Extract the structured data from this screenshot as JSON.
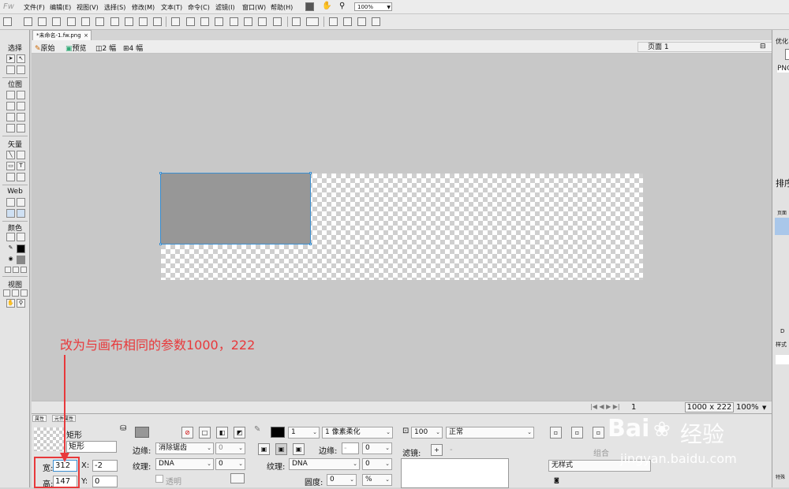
{
  "app": {
    "logo_text": "Fw",
    "menus": [
      "文件(F)",
      "编辑(E)",
      "视图(V)",
      "选择(S)",
      "修改(M)",
      "文本(T)",
      "命令(C)",
      "滤镜(I)",
      "窗口(W)",
      "帮助(H)"
    ],
    "zoom": "100%"
  },
  "document": {
    "tab_title": "*未命名-1.fw.png",
    "close": "×"
  },
  "view_tabs": [
    "原始",
    "预览",
    "2 幅",
    "4 幅"
  ],
  "page_selector": "页面 1",
  "tools": {
    "select_title": "选择",
    "bitmap_title": "位图",
    "vector_title": "矢量",
    "web_title": "Web",
    "colors_title": "颜色",
    "view_title": "视图"
  },
  "annotation": "改为与画布相同的参数1000，222",
  "status": {
    "page_number": "1",
    "canvas_size": "1000 x 222",
    "zoom": "100%"
  },
  "right_panel": {
    "optimize_label": "优化",
    "png_label": "PNG",
    "sort_label": "排序",
    "pages_label": "页面",
    "styles_label": "样式",
    "special_label": "特殊"
  },
  "properties": {
    "tab_props": "属性",
    "tab_symbols": "元件属性",
    "object_kind": "矩形",
    "object_name": "矩形",
    "width_label": "宽:",
    "width_value": "312",
    "height_label": "高:",
    "height_value": "147",
    "x_label": "X:",
    "x_value": "-2",
    "y_label": "Y:",
    "y_value": "0",
    "fill_edge_label": "边缘:",
    "fill_edge_value": "消除锯齿",
    "fill_edge_amount": "0",
    "fill_texture_label": "纹理:",
    "fill_texture_value": "DNA",
    "fill_texture_amount": "0",
    "transparent_label": "透明",
    "stroke_size": "1",
    "stroke_type": "1 像素柔化",
    "stroke_edge_label": "边缘:",
    "stroke_edge_amount": "0",
    "stroke_texture_label": "纹理:",
    "stroke_texture_value": "DNA",
    "stroke_texture_amount": "0",
    "roundness_label": "圆度:",
    "roundness_value": "0",
    "roundness_unit": "%",
    "opacity": "100",
    "blend_mode": "正常",
    "filters_label": "滤镜:",
    "add_filter": "+",
    "remove_filter": "-",
    "group_label": "组合",
    "style_select": "无样式"
  },
  "watermark": {
    "brand": "Bai",
    "brand_cn": "经验",
    "url": "jingyan.baidu.com"
  },
  "colors": {
    "accent_red": "#e8393b",
    "selection_blue": "#3b8fd1",
    "rect_fill": "#979797"
  }
}
